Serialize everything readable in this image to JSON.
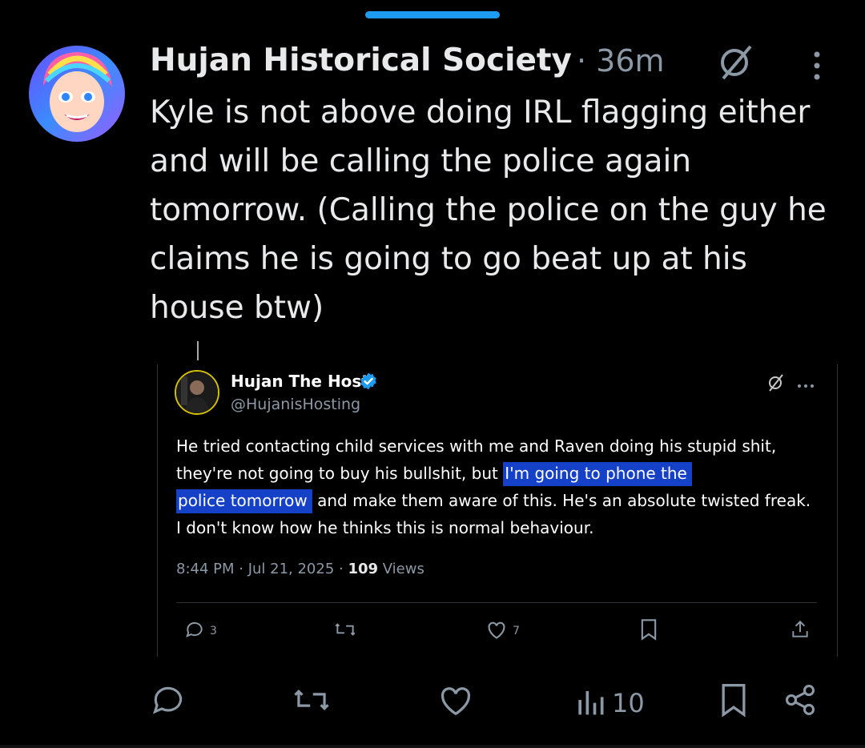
{
  "post": {
    "author_name": "Hujan Historical Society",
    "time": "· 36m",
    "text": "Kyle is not above doing IRL flagging either and will be calling the police again tomorrow. (Calling the police on the guy he claims he is going to go beat up at his house btw)"
  },
  "quote": {
    "author_name": "Hujan The Host",
    "handle": "@HujanisHosting",
    "text_before": "He tried contacting child services with me and Raven doing his stupid shit, they're not going to buy his bullshit, but ",
    "text_highlight_1": "I'm going to phone the",
    "text_highlight_2": "police tomorrow",
    "text_after": " and make them aware of this. He's an absolute twisted freak. I don't know how he thinks this is normal behaviour.",
    "timestamp": "8:44 PM · Jul 21, 2025 · ",
    "views_count": "109",
    "views_label": " Views",
    "replies": "3",
    "likes": "7"
  },
  "actions": {
    "views": "10"
  },
  "colors": {
    "accent": "#1d9bf0",
    "highlight": "#1540c8",
    "muted": "#8b98a5"
  },
  "icons": [
    "reply-icon",
    "repost-icon",
    "like-icon",
    "views-icon",
    "bookmark-icon",
    "share-icon",
    "grok-icon",
    "more-icon",
    "verified-badge-icon"
  ]
}
